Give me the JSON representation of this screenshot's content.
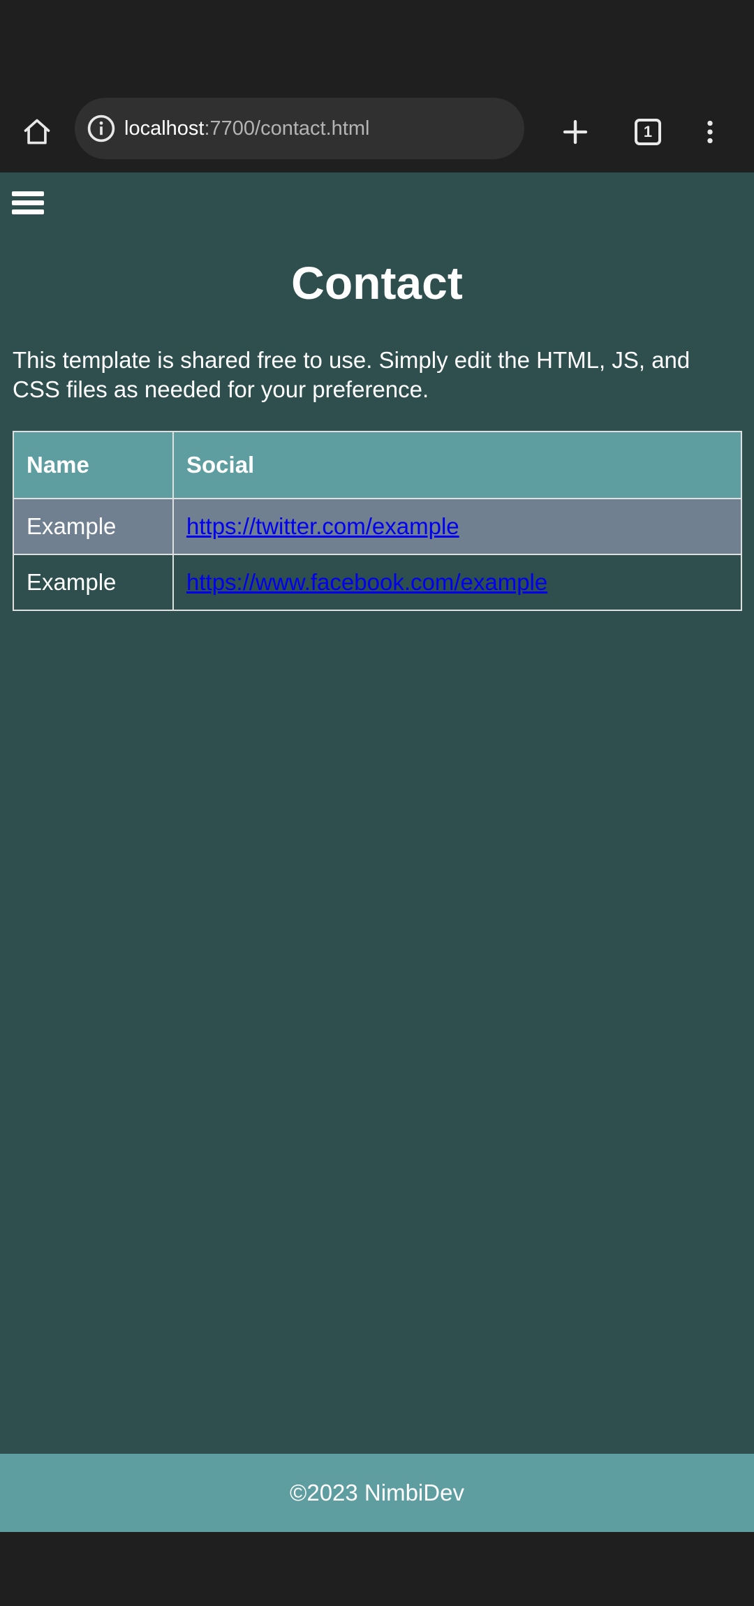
{
  "browser": {
    "url_host": "localhost",
    "url_rest": ":7700/contact.html",
    "tab_count": "1"
  },
  "page": {
    "title": "Contact",
    "intro": "This template is shared free to use. Simply edit the HTML, JS, and CSS files as needed for your preference.",
    "table": {
      "headers": [
        "Name",
        "Social"
      ],
      "rows": [
        {
          "name": "Example",
          "social": "https://twitter.com/example"
        },
        {
          "name": "Example",
          "social": "https://www.facebook.com/example"
        }
      ]
    },
    "footer": "©2023 NimbiDev"
  },
  "colors": {
    "page_bg": "#2f4f4f",
    "header_bg": "#5f9ea0",
    "alt_row_bg": "#708090",
    "link": "#0000ee",
    "browser_chrome": "#1f1f1f"
  },
  "icons": [
    "home-icon",
    "info-icon",
    "plus-icon",
    "tab-switcher-icon",
    "more-vert-icon",
    "hamburger-menu-icon"
  ]
}
